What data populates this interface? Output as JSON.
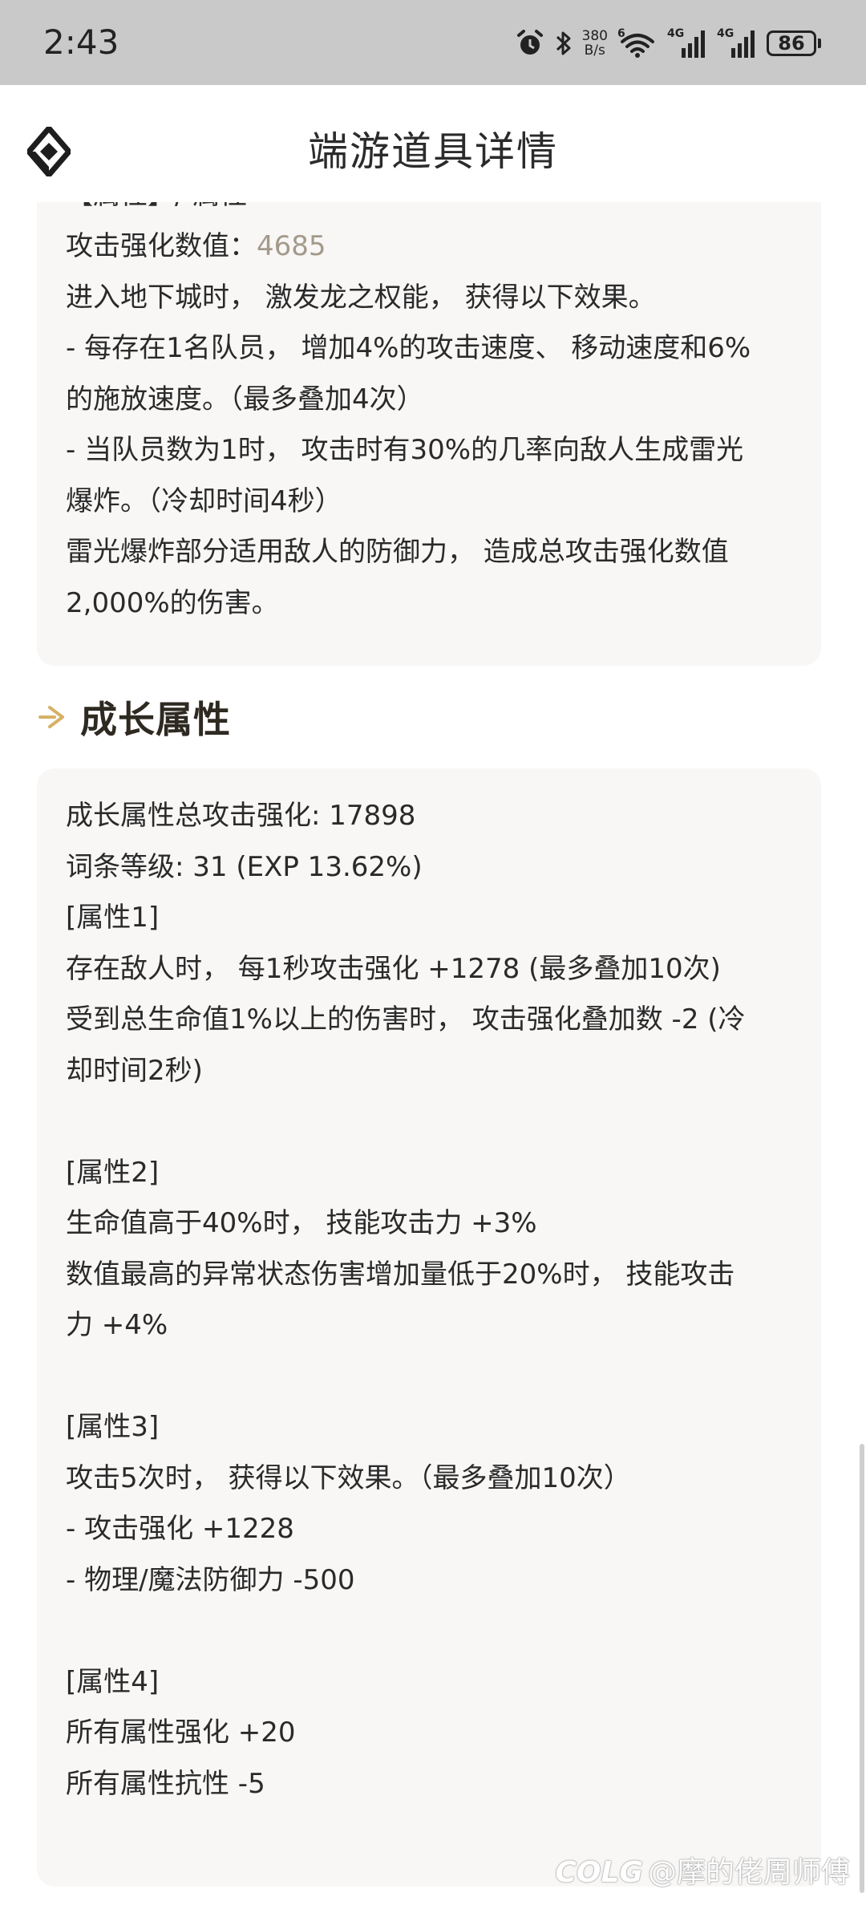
{
  "status_bar": {
    "time": "2:43",
    "net_speed_value": "380",
    "net_speed_unit": "B/s",
    "wifi_tag": "6",
    "signal_1_tag": "4G",
    "signal_2_tag": "4G",
    "battery": "86"
  },
  "header": {
    "title": "端游道具详情"
  },
  "card_top": {
    "clipped_line": "【属性】/ 属性",
    "attack_label": "攻击强化数值：",
    "attack_value": "4685",
    "lines": [
      "进入地下城时， 激发龙之权能， 获得以下效果。",
      "- 每存在1名队员， 增加4%的攻击速度、 移动速度和6%",
      "的施放速度。（最多叠加4次）",
      "- 当队员数为1时， 攻击时有30%的几率向敌人生成雷光",
      "爆炸。（冷却时间4秒）",
      "雷光爆炸部分适用敌人的防御力， 造成总攻击强化数值",
      "2,000%的伤害。"
    ]
  },
  "section": {
    "title": "成长属性"
  },
  "growth": {
    "lines": [
      "成长属性总攻击强化: 17898",
      "词条等级: 31 (EXP 13.62%)",
      "[属性1]",
      "存在敌人时， 每1秒攻击强化 +1278 (最多叠加10次)",
      "受到总生命值1%以上的伤害时， 攻击强化叠加数 -2 (冷",
      "却时间2秒)",
      "",
      "[属性2]",
      "生命值高于40%时， 技能攻击力 +3%",
      "数值最高的异常状态伤害增加量低于20%时， 技能攻击",
      "力 +4%",
      "",
      "[属性3]",
      "攻击5次时， 获得以下效果。（最多叠加10次）",
      "- 攻击强化 +1228",
      "- 物理/魔法防御力 -500",
      "",
      "[属性4]",
      "所有属性强化 +20",
      "所有属性抗性 -5"
    ]
  },
  "watermark": {
    "logo": "COLG",
    "text": "@摩的佬周师傅"
  }
}
